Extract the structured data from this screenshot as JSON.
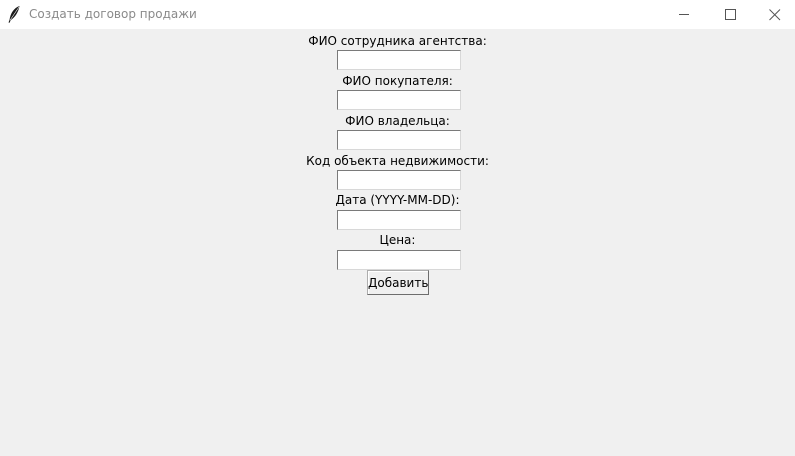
{
  "window": {
    "title": "Создать договор продажи",
    "icon": "feather-icon",
    "controls": [
      "minimize-icon",
      "maximize-icon",
      "close-icon"
    ]
  },
  "form": {
    "fields": [
      {
        "label": "ФИО сотрудника агентства:",
        "value": ""
      },
      {
        "label": "ФИО покупателя:",
        "value": ""
      },
      {
        "label": "ФИО владельца:",
        "value": ""
      },
      {
        "label": "Код объекта недвижимости:",
        "value": ""
      },
      {
        "label": "Дата (YYYY-MM-DD):",
        "value": ""
      },
      {
        "label": "Цена:",
        "value": ""
      }
    ],
    "submit_label": "Добавить"
  }
}
